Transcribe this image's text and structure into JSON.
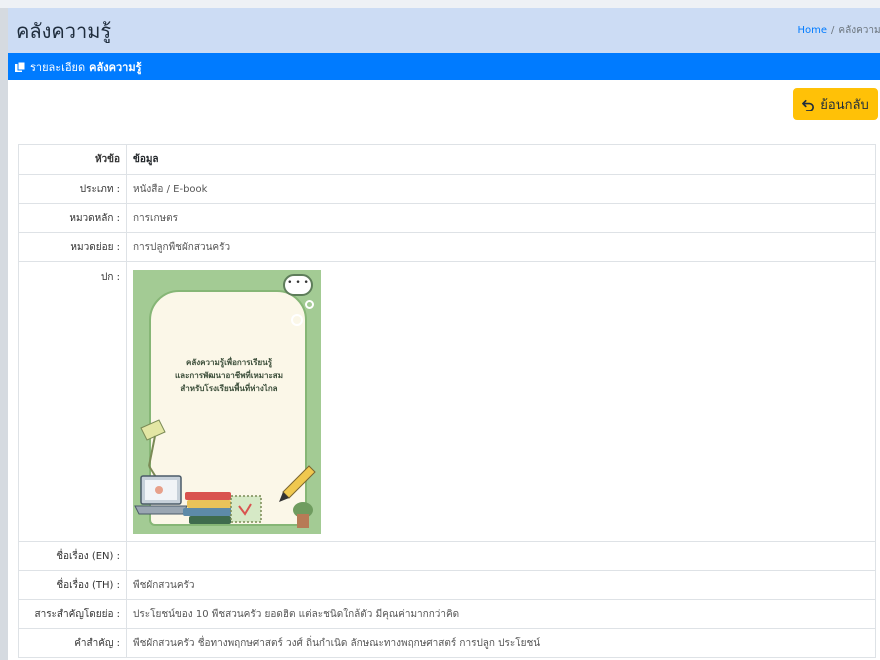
{
  "header": {
    "title": "คลังความรู้",
    "breadcrumb_home": "Home",
    "breadcrumb_separator": "/",
    "breadcrumb_current": "คลังความรู้"
  },
  "card": {
    "header_prefix": "รายละเอียด",
    "header_bold": "คลังความรู้",
    "back_label": "ย้อนกลับ"
  },
  "table": {
    "col_key": "หัวข้อ",
    "col_value": "ข้อมูล",
    "rows": [
      {
        "label": "ประเภท :",
        "value": "หนังสือ / E-book"
      },
      {
        "label": "หมวดหลัก :",
        "value": "การเกษตร"
      },
      {
        "label": "หมวดย่อย :",
        "value": "การปลูกพืชผักสวนครัว"
      },
      {
        "label": "ปก :",
        "value": ""
      },
      {
        "label": "ชื่อเรื่อง (EN) :",
        "value": ""
      },
      {
        "label": "ชื่อเรื่อง (TH) :",
        "value": "พืชผักสวนครัว"
      },
      {
        "label": "สาระสำคัญโดยย่อ :",
        "value": "ประโยชน์ของ 10 พืชสวนครัว ยอดฮิต แต่ละชนิดใกล้ตัว มีคุณค่ามากกว่าคิด"
      },
      {
        "label": "คำสำคัญ :",
        "value": "พืชผักสวนครัว ชื่อทางพฤกษศาสตร์ วงศ์ ถิ่นกำเนิด ลักษณะทางพฤกษศาสตร์ การปลูก ประโยชน์"
      }
    ]
  },
  "cover": {
    "title_line1": "คลังความรู้เพื่อการเรียนรู้",
    "title_line2": "และการพัฒนาอาชีพที่เหมาะสม",
    "title_line3": "สำหรับโรงเรียนพื้นที่ห่างไกล",
    "bubble_text": "• • •"
  },
  "colors": {
    "primary": "#007bff",
    "warning": "#ffc107",
    "header_bg": "#ccdcf4",
    "cover_bg": "#a3cb94"
  },
  "icons": {
    "card_header": "copy-icon",
    "back": "undo-icon"
  }
}
